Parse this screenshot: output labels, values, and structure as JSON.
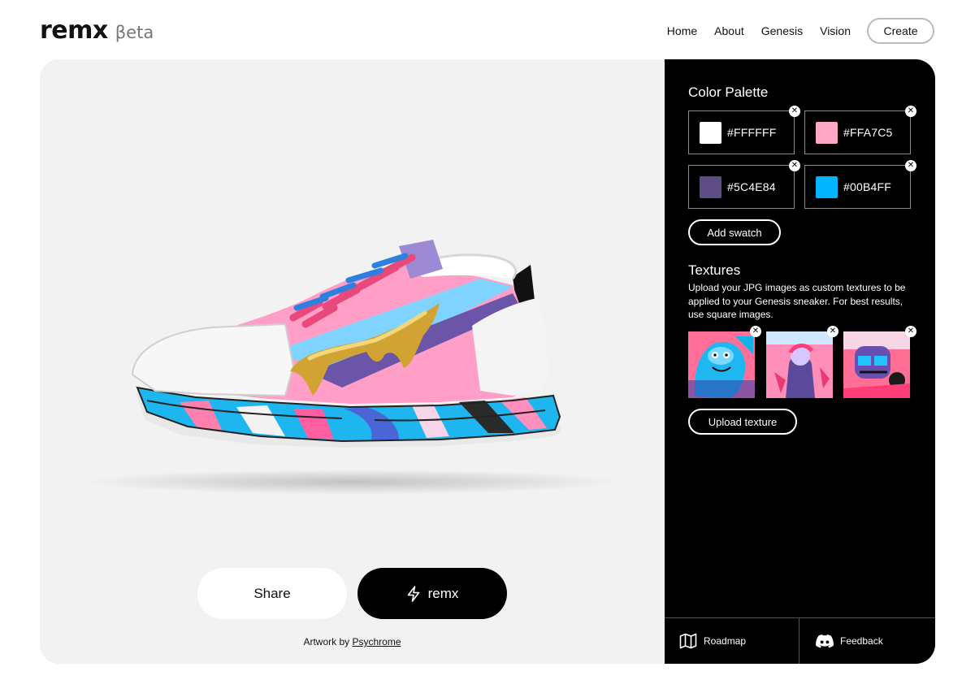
{
  "header": {
    "logo": "remx",
    "badge": "βeta",
    "nav": [
      "Home",
      "About",
      "Genesis",
      "Vision"
    ],
    "create_label": "Create"
  },
  "stage": {
    "share_label": "Share",
    "remx_label": "remx",
    "credit_prefix": "Artwork by ",
    "credit_artist": "Psychrome"
  },
  "palette": {
    "title": "Color Palette",
    "swatches": [
      {
        "hex": "#FFFFFF",
        "color": "#FFFFFF"
      },
      {
        "hex": "#FFA7C5",
        "color": "#FFA7C5"
      },
      {
        "hex": "#5C4E84",
        "color": "#5C4E84"
      },
      {
        "hex": "#00B4FF",
        "color": "#00B4FF"
      }
    ],
    "add_label": "Add swatch"
  },
  "textures": {
    "title": "Textures",
    "description": "Upload your JPG images as custom textures to be applied to your Genesis sneaker. For best results, use square images.",
    "upload_label": "Upload texture"
  },
  "footer": {
    "roadmap_label": "Roadmap",
    "feedback_label": "Feedback"
  },
  "icons": {
    "remx": "lightning-bolt-icon",
    "remove": "close-icon",
    "roadmap": "map-icon",
    "feedback": "discord-icon"
  }
}
